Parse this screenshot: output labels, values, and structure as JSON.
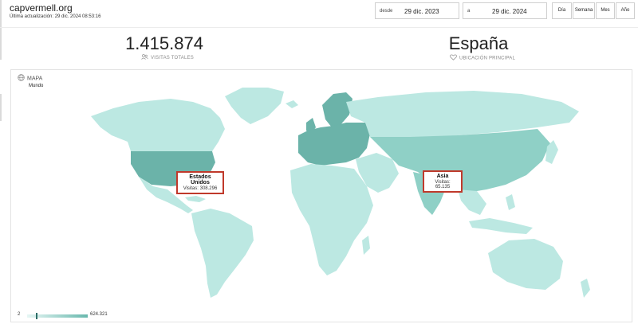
{
  "header": {
    "site": "capvermell.org",
    "last_update": "Última actualización: 29 dic. 2024 08:53:16"
  },
  "date_range": {
    "from_label": "desde",
    "from_value": "29 dic. 2023",
    "to_label": "a",
    "to_value": "29 dic. 2024"
  },
  "range_buttons": [
    "Día",
    "Semana",
    "Mes",
    "Año"
  ],
  "stats": {
    "total_visits": {
      "value": "1.415.874",
      "label": "VISITAS TOTALES",
      "icon": "people-icon"
    },
    "main_location": {
      "value": "España",
      "label": "UBICACIÓN PRINCIPAL",
      "icon": "heart-icon"
    }
  },
  "map": {
    "title": "MAPA",
    "subtitle": "Mundo",
    "tooltips": [
      {
        "name": "Estados Unidos",
        "visits": "Visitas: 308.296"
      },
      {
        "name": "Asia",
        "visits": "Visitas: 65.135"
      }
    ],
    "legend": {
      "min": "2",
      "max": "624.321"
    },
    "colors": {
      "light": "#bce8e2",
      "medium": "#8fd0c6",
      "dark": "#6bb3a9",
      "tooltip_border": "#c0392b"
    }
  }
}
